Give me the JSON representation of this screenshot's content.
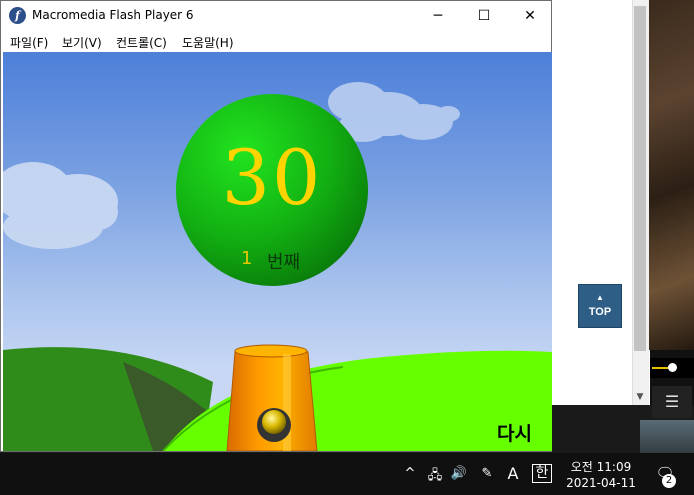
{
  "window": {
    "title": "Macromedia Flash Player 6",
    "app_icon": "f",
    "minimize": "─",
    "maximize": "☐",
    "close": "✕"
  },
  "menu": {
    "file": "파일(F)",
    "view": "보기(V)",
    "control": "컨트롤(C)",
    "help": "도움말(H)"
  },
  "game": {
    "ball_number": "30",
    "count_number": "1",
    "count_label": "번째",
    "retry": "다시"
  },
  "page": {
    "top_button": "TOP",
    "top_arrow": "▲",
    "scroll_down": "▼",
    "menu_icon": "☰"
  },
  "taskbar": {
    "chevron": "^",
    "network": "🖧",
    "volume": "🔊",
    "pen": "✎",
    "ime_mode": "A",
    "ime_lang": "한",
    "time": "오전 11:09",
    "date": "2021-04-11",
    "notification_icon": "🗨",
    "notification_count": "2"
  },
  "colors": {
    "sky_top": "#4d7fd9",
    "ball_green": "#1fb51f",
    "number_yellow": "#ffd400",
    "grass": "#66ff00",
    "cannon_orange": "#ff9900",
    "top_button": "#2e5d85"
  }
}
